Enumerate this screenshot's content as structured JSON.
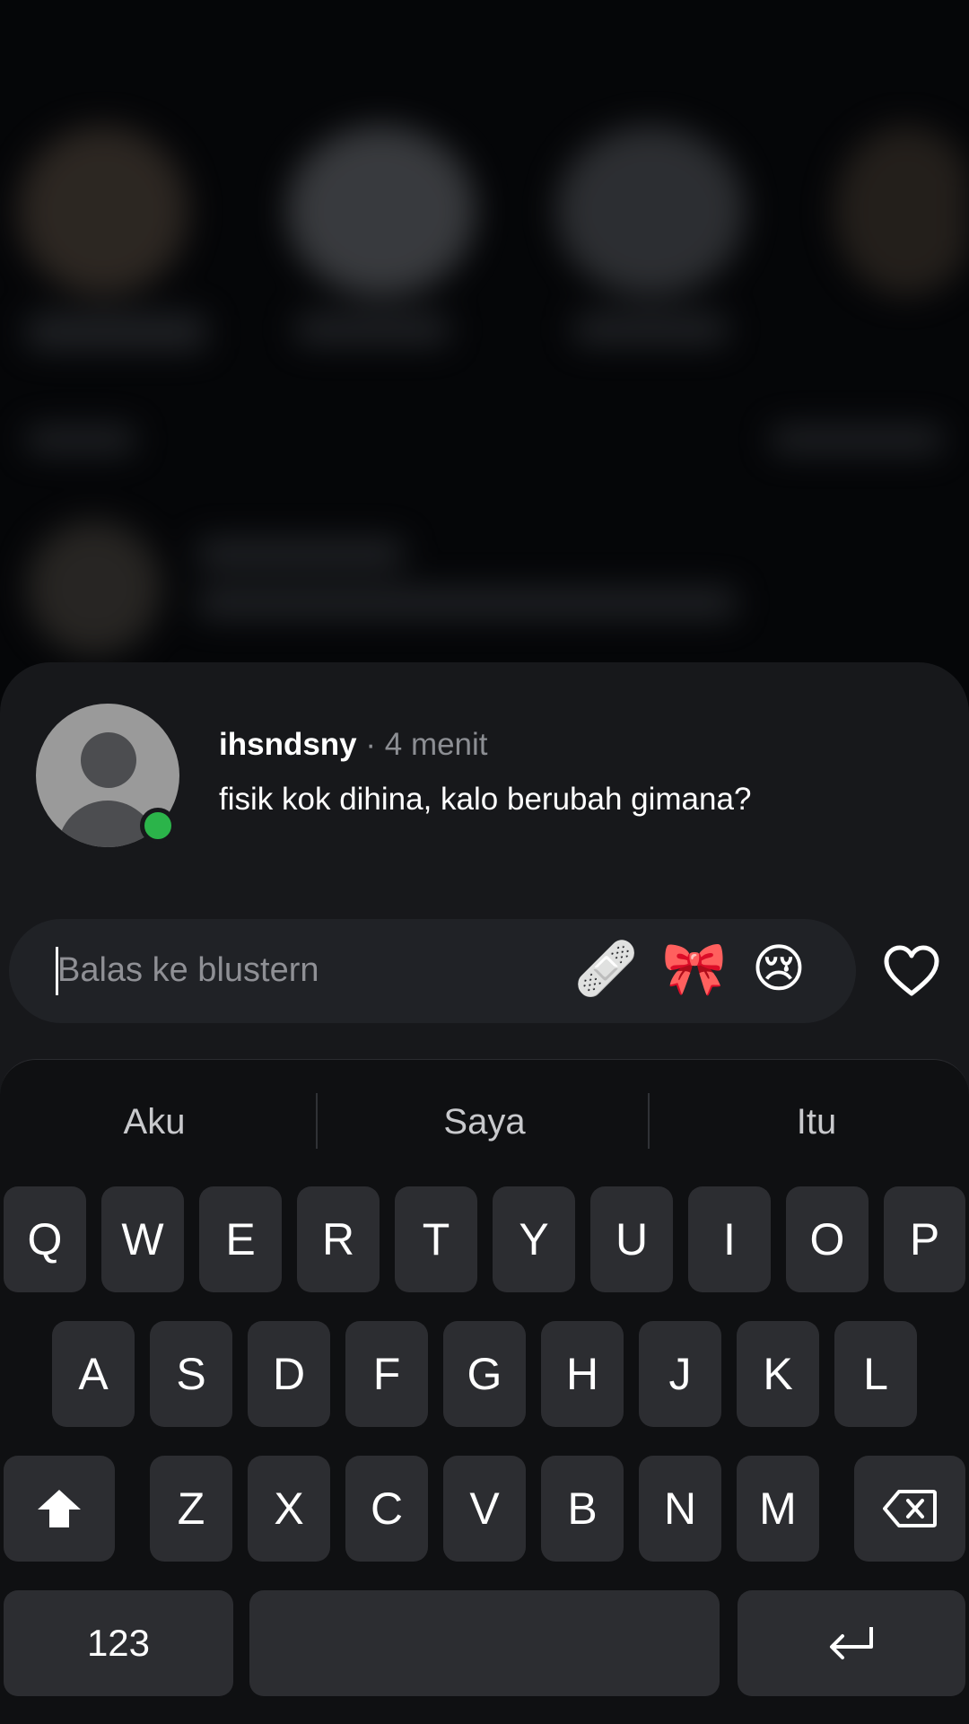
{
  "message": {
    "username": "ihsndsny",
    "separator": " · ",
    "time": "4 menit",
    "text": "fisik kok dihina, kalo berubah gimana?"
  },
  "reply": {
    "placeholder": "Balas ke blustern",
    "emojis": [
      "🩹",
      "🎀",
      "😢"
    ]
  },
  "keyboard": {
    "suggestions": [
      "Aku",
      "Saya",
      "Itu"
    ],
    "row1": [
      "Q",
      "W",
      "E",
      "R",
      "T",
      "Y",
      "U",
      "I",
      "O",
      "P"
    ],
    "row2": [
      "A",
      "S",
      "D",
      "F",
      "G",
      "H",
      "J",
      "K",
      "L"
    ],
    "row3": [
      "Z",
      "X",
      "C",
      "V",
      "B",
      "N",
      "M"
    ],
    "numbers_label": "123"
  },
  "colors": {
    "online": "#2bb44a",
    "sheet": "#17181b",
    "key": "#2c2d31"
  },
  "icons": {
    "bandage": "adhesive-bandage-icon",
    "ribbon": "ribbon-icon",
    "crying": "crying-face-icon",
    "heart": "heart-outline-icon",
    "shift": "shift-arrow-icon",
    "backspace": "backspace-icon",
    "return": "return-icon"
  }
}
